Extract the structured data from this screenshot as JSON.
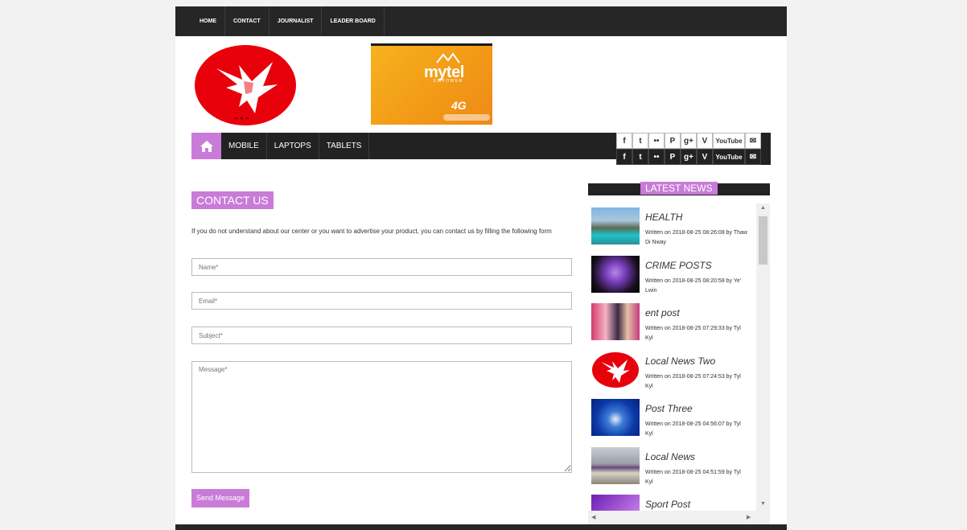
{
  "top_nav": [
    "HOME",
    "CONTACT",
    "JOURNALIST",
    "LEADER BOARD"
  ],
  "ad": {
    "brand": "mytel",
    "tagline": "EMPOWER",
    "badge": "4G"
  },
  "main_nav": [
    "MOBILE",
    "LAPTOPS",
    "TABLETS"
  ],
  "social_icons": [
    "facebook-icon",
    "twitter-icon",
    "flickr-icon",
    "pinterest-icon",
    "google-plus-icon",
    "vimeo-icon",
    "youtube-icon",
    "mail-icon"
  ],
  "social_glyphs": {
    "facebook": "f",
    "twitter": "t",
    "flickr": "••",
    "pinterest": "P",
    "googleplus": "g+",
    "vimeo": "V",
    "youtube": "YouTube",
    "mail": "✉"
  },
  "contact": {
    "heading": "CONTACT US",
    "intro": "If you do not understand about our center or you want to advertise your product, you can contact us by filling the following form",
    "name_placeholder": "Name*",
    "email_placeholder": "Email*",
    "subject_placeholder": "Subject*",
    "message_placeholder": "Message*",
    "send_label": "Send Message"
  },
  "latest_news": {
    "heading": "LATEST NEWS",
    "items": [
      {
        "title": "HEALTH",
        "meta": "Written on 2018-08-25 08:26:08 by Thaw Di Nway"
      },
      {
        "title": "CRIME POSTS",
        "meta": "Written on 2018-08-25 08:20:58 by Ye' Lwin"
      },
      {
        "title": "ent post",
        "meta": "Written on 2018-08-25 07:29:33 by Tyl Kyl"
      },
      {
        "title": "Local News Two",
        "meta": "Written on 2018-08-25 07:24:53 by Tyl Kyl"
      },
      {
        "title": "Post Three",
        "meta": "Written on 2018-08-25 04:56:07 by Tyl Kyl"
      },
      {
        "title": "Local News",
        "meta": "Written on 2018-08-25 04:51:59 by Tyl Kyl"
      },
      {
        "title": "Sport Post",
        "meta": ""
      }
    ]
  },
  "colors": {
    "accent": "#c97bd8",
    "nav_bg": "#262626",
    "logo_red": "#e8000b"
  }
}
